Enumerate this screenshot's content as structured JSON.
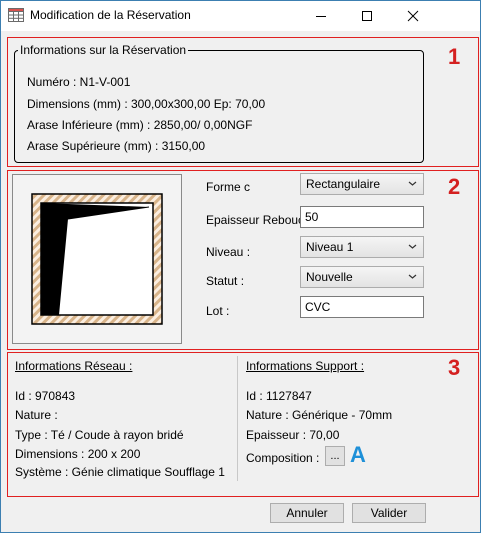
{
  "window": {
    "title": "Modification de la Réservation",
    "icon": "table-icon"
  },
  "section_markers": [
    "1",
    "2",
    "3"
  ],
  "annotation_marker": "A",
  "info_group": {
    "title": "Informations sur la Réservation",
    "numero": "Numéro :  N1-V-001",
    "dimensions": "Dimensions  (mm) : 300,00x300,00 Ep: 70,00",
    "arase_inf": "Arase Inférieure  (mm) : 2850,00/  0,00NGF",
    "arase_sup": "Arase Supérieure  (mm) : 3150,00"
  },
  "form": {
    "forme_label": "Forme c",
    "forme_value": "Rectangulaire",
    "epaisseur_label": "Epaisseur Rebouc",
    "epaisseur_value": "50",
    "niveau_label": "Niveau :",
    "niveau_value": "Niveau 1",
    "statut_label": "Statut :",
    "statut_value": "Nouvelle",
    "lot_label": "Lot :",
    "lot_value": "CVC"
  },
  "reseau": {
    "title": "Informations Réseau :",
    "id": "Id : 970843",
    "nature": "Nature :",
    "type": "Type : Té / Coude à rayon bridé",
    "dimensions": "Dimensions : 200 x 200",
    "systeme": "Système : Génie climatique Soufflage 1"
  },
  "support": {
    "title": "Informations Support :",
    "id": "Id : 1127847",
    "nature": "Nature : Générique - 70mm",
    "epaisseur": "Epaisseur : 70,00",
    "composition": "Composition :",
    "composition_button": "..."
  },
  "buttons": {
    "cancel": "Annuler",
    "validate": "Valider"
  },
  "colors": {
    "annotation_red": "#d42020",
    "annotation_blue": "#1e90d8",
    "hatch": "#d8b48a"
  }
}
